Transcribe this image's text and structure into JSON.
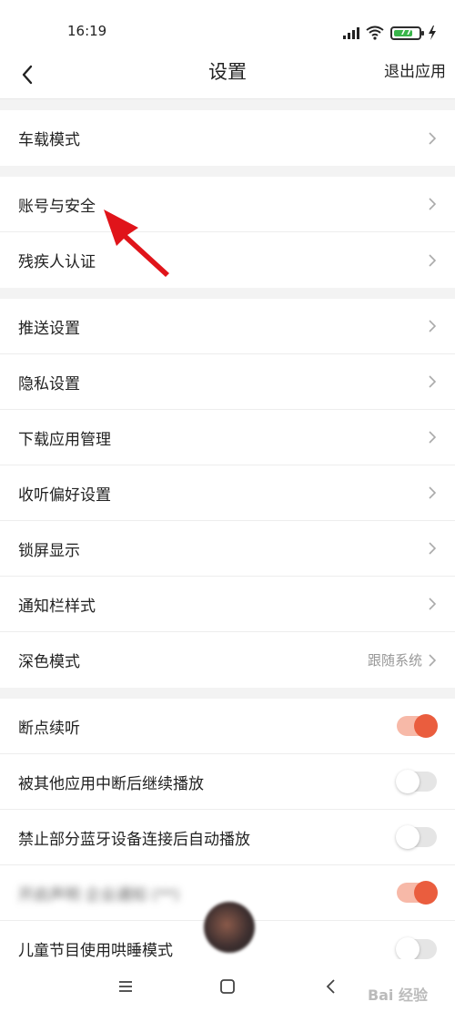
{
  "status_bar": {
    "time": "16:19",
    "battery": "77"
  },
  "header": {
    "title": "设置",
    "exit_label": "退出应用"
  },
  "groups": [
    [
      {
        "label": "车载模式",
        "type": "link"
      }
    ],
    [
      {
        "label": "账号与安全",
        "type": "link"
      },
      {
        "label": "残疾人认证",
        "type": "link"
      }
    ],
    [
      {
        "label": "推送设置",
        "type": "link"
      },
      {
        "label": "隐私设置",
        "type": "link"
      },
      {
        "label": "下载应用管理",
        "type": "link"
      },
      {
        "label": "收听偏好设置",
        "type": "link"
      },
      {
        "label": "锁屏显示",
        "type": "link"
      },
      {
        "label": "通知栏样式",
        "type": "link"
      },
      {
        "label": "深色模式",
        "type": "link",
        "value": "跟随系统"
      }
    ],
    [
      {
        "label": "断点续听",
        "type": "toggle",
        "on": true
      },
      {
        "label": "被其他应用中断后继续播放",
        "type": "toggle",
        "on": false
      },
      {
        "label": "禁止部分蓝牙设备连接后自动播放",
        "type": "toggle",
        "on": false
      },
      {
        "label": "开启声明 企业通知 (**)",
        "type": "toggle",
        "on": true,
        "blurred": true
      },
      {
        "label": "儿童节目使用哄睡模式",
        "type": "toggle",
        "on": false
      }
    ]
  ],
  "icons": {
    "back": "back-arrow-icon",
    "chevron": "chevron-right-icon",
    "menu": "menu-icon",
    "home": "home-icon",
    "back_nav": "back-nav-icon"
  },
  "colors": {
    "accent": "#ea5d3e",
    "battery": "#39b54a",
    "annotation": "#e0141a"
  },
  "watermark": "Bai 经验"
}
